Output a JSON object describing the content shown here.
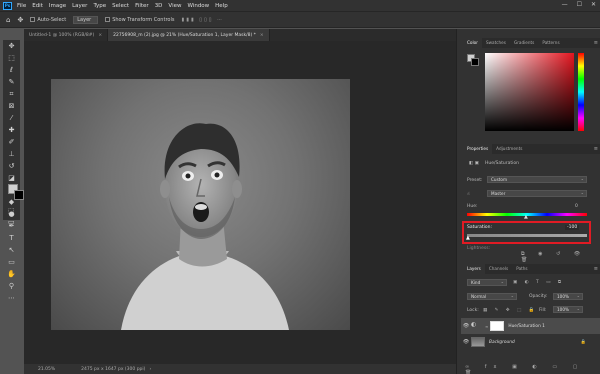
{
  "menu": {
    "logo": "Ps",
    "items": [
      "File",
      "Edit",
      "Image",
      "Layer",
      "Type",
      "Select",
      "Filter",
      "3D",
      "View",
      "Window",
      "Help"
    ]
  },
  "window_controls": {
    "minimize": "—",
    "restore": "☐",
    "close": "✕"
  },
  "options": {
    "auto_select": "Auto-Select",
    "auto_select_target": "Layer",
    "transform_controls": "Show Transform Controls"
  },
  "tabs": [
    {
      "label": "Untitled-1 @ 100% (RGB/8#)",
      "close": "×"
    },
    {
      "label": "22756908_m (2).jpg @ 21% (Hue/Saturation 1, Layer Mask/8) *",
      "close": "×"
    }
  ],
  "status": {
    "zoom": "21.05%",
    "doc": "2475 px x 1647 px (300 ppi)"
  },
  "color_panel": {
    "tabs": [
      "Color",
      "Swatches",
      "Gradients",
      "Patterns"
    ]
  },
  "properties": {
    "tabs": [
      "Properties",
      "Adjustments"
    ],
    "adjustment": "Hue/Saturation",
    "preset_label": "Preset:",
    "preset_value": "Custom",
    "channel_value": "Master",
    "hue_label": "Hue:",
    "hue_value": "0",
    "saturation_label": "Saturation:",
    "saturation_value": "-100",
    "saturation_level": 0,
    "lightness_label": "Lightness:"
  },
  "layers": {
    "tabs": [
      "Layers",
      "Channels",
      "Paths"
    ],
    "filter_label": "Kind",
    "blend_mode": "Normal",
    "opacity_label": "Opacity:",
    "opacity_value": "100%",
    "lock_label": "Lock:",
    "fill_label": "Fill:",
    "fill_value": "100%",
    "rows": [
      {
        "name": "Hue/Saturation 1"
      },
      {
        "name": "Background"
      }
    ]
  },
  "colors": {
    "highlight": "#e01b24",
    "accent": "#31a8ff"
  }
}
